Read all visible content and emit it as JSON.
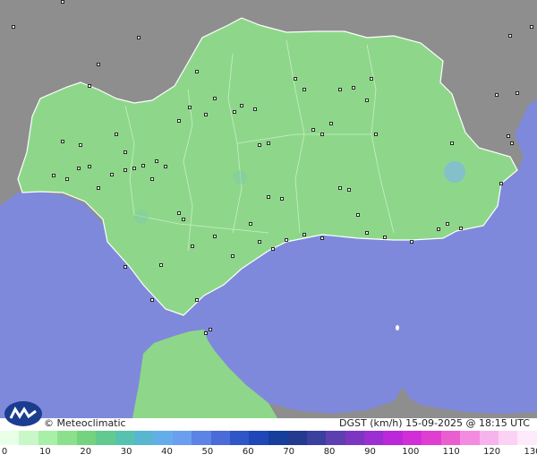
{
  "credit": "© Meteoclimatic",
  "map_title": "DGST (km/h)  15-09-2025 @ 18:15 UTC",
  "scale": {
    "ticks": [
      "0",
      "10",
      "20",
      "30",
      "40",
      "50",
      "60",
      "70",
      "80",
      "90",
      "100",
      "110",
      "120",
      "130"
    ],
    "colors": [
      "#e8ffe8",
      "#c8f7c8",
      "#a8efa8",
      "#8ce08c",
      "#74d37f",
      "#62c98f",
      "#58c2b0",
      "#58b6d0",
      "#63aee8",
      "#6c9ef0",
      "#5b84e6",
      "#4a6bd8",
      "#2f56c6",
      "#1f47b7",
      "#153e9d",
      "#243a8f",
      "#3b3f9e",
      "#5d3fb0",
      "#7d36c1",
      "#9b2fd1",
      "#ba28da",
      "#d22ed8",
      "#e03ed0",
      "#ea5fcf",
      "#f38ce0",
      "#f7b4ec",
      "#fbd2f4",
      "#fdeafb"
    ]
  },
  "colors": {
    "sea": "#7f89db",
    "land_main": "#8ed78a",
    "land_other": "#8e8e8e",
    "border": "#ffffff"
  }
}
